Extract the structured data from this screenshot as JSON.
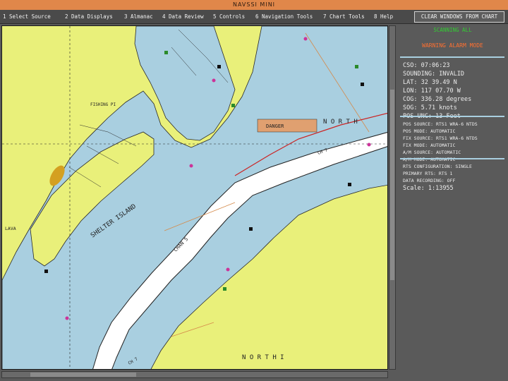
{
  "window": {
    "title": "NAVSSI MINI"
  },
  "menu": {
    "items": [
      {
        "key": "1",
        "label": "Select Source"
      },
      {
        "key": "2",
        "label": "Data Displays"
      },
      {
        "key": "3",
        "label": "Almanac"
      },
      {
        "key": "4",
        "label": "Data Review"
      },
      {
        "key": "5",
        "label": "Controls"
      },
      {
        "key": "6",
        "label": "Navigation Tools"
      },
      {
        "key": "7",
        "label": "Chart Tools"
      },
      {
        "key": "8",
        "label": "Help"
      }
    ],
    "clear_button": "CLEAR WINDOWS FROM CHART"
  },
  "chart": {
    "labels": {
      "danger": "DANGER",
      "fishing_pier": "FISHING PI",
      "shelter_island": "SHELTER ISLAND",
      "north_top": "N O R T H",
      "north_bottom": "N O R T H   I",
      "channel_1": "CHAN 5",
      "channel_2": "CH 7",
      "channel_3": "CH 7",
      "lava": "LAVA"
    },
    "colors": {
      "land": "#e9f07a",
      "water": "#a9cfe0",
      "channel": "#ffffff",
      "danger": "#e0a070"
    }
  },
  "status": {
    "source_line": "SCANNING  ALL",
    "alarm": "WARNING ALARM MODE",
    "cso": {
      "label": "CSO:",
      "value": "07:06:23"
    },
    "sounding": {
      "label": "SOUNDING:",
      "value": "INVALID"
    },
    "lat": {
      "label": "LAT:",
      "value": "32 39.49 N"
    },
    "lon": {
      "label": "LON:",
      "value": "117 07.70 W"
    },
    "cog": {
      "label": "COG:",
      "value": "336.28 degrees"
    },
    "sog": {
      "label": "SOG:",
      "value": "5.71 knots"
    },
    "pos_unc": {
      "label": "POS UNC:",
      "value": "13 Feet"
    },
    "modes": [
      {
        "label": "POS SOURCE:",
        "value": "RTS1 WRA-6 NTDS"
      },
      {
        "label": "POS MODE:",
        "value": "AUTOMATIC"
      },
      {
        "label": "FIX SOURCE:",
        "value": "RTS1 WRA-6 NTDS"
      },
      {
        "label": "FIX MODE:",
        "value": "AUTOMATIC"
      },
      {
        "label": "A/M SOURCE:",
        "value": "AUTOMATIC"
      },
      {
        "label": "A/M MODE:",
        "value": "AUTOMATIC"
      }
    ],
    "rts_config": {
      "label": "RTS CONFIGURATION:",
      "value": "SINGLE"
    },
    "primary_rts": {
      "label": "PRIMARY RTS:",
      "value": "RTS 1"
    },
    "data_recording": {
      "label": "DATA RECORDING:",
      "value": "OFF"
    },
    "scale": {
      "label": "Scale:",
      "value": "1:13955"
    }
  }
}
